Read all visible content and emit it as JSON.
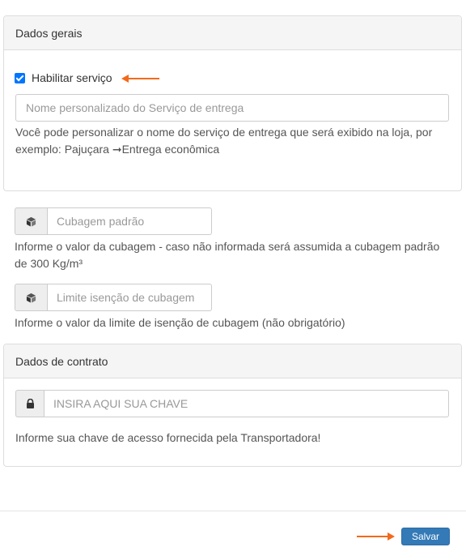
{
  "general_panel": {
    "title": "Dados gerais",
    "enable_service_label": "Habilitar serviço",
    "enable_service_checked": true,
    "service_name_placeholder": "Nome personalizado do Serviço de entrega",
    "service_name_help_line1": "Você pode personalizar o nome do serviço de entrega que será exibido na loja, por",
    "service_name_help_line2": "exemplo: Pajuçara ➞Entrega econômica"
  },
  "cubage": {
    "default_placeholder": "Cubagem padrão",
    "default_help_line1": "Informe o valor da cubagem - caso não informada será assumida a cubagem padrão",
    "default_help_line2": "de 300 Kg/m³",
    "exemption_placeholder": "Limite isenção de cubagem",
    "exemption_help": "Informe o valor da limite de isenção de cubagem (não obrigatório)"
  },
  "contract_panel": {
    "title": "Dados de contrato",
    "key_placeholder": "INSIRA AQUI SUA CHAVE",
    "key_help": "Informe sua chave de acesso fornecida pela Transportadora!"
  },
  "footer": {
    "save_label": "Salvar"
  },
  "colors": {
    "annotation_arrow": "#f26a1b",
    "primary_button": "#337ab7",
    "checkbox": "#0075ff"
  }
}
